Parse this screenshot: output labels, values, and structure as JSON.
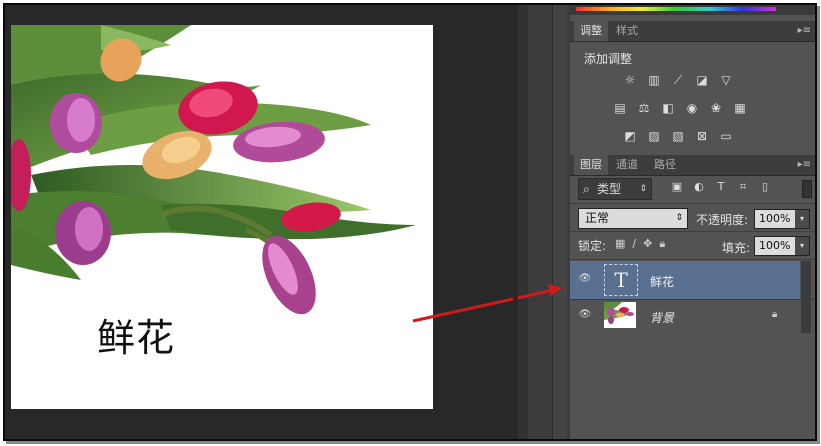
{
  "canvas": {
    "text": "鲜花"
  },
  "adjustments_panel": {
    "tabs": [
      {
        "label": "调整"
      },
      {
        "label": "样式"
      }
    ],
    "title": "添加调整",
    "rows": [
      [
        "sun-icon",
        "levels-icon",
        "curves-icon",
        "exposure-icon",
        "triangle-icon"
      ],
      [
        "vibrance-icon",
        "balance-icon",
        "black-white-icon",
        "photo-filter-icon",
        "channel-mixer-icon",
        "color-lookup-icon"
      ],
      [
        "invert-icon",
        "posterize-icon",
        "threshold-icon",
        "selective-color-icon",
        "gradient-map-icon"
      ]
    ]
  },
  "layers_panel": {
    "tabs": [
      {
        "label": "图层"
      },
      {
        "label": "通道"
      },
      {
        "label": "路径"
      }
    ],
    "filter_kind": "类型",
    "blend_mode": "正常",
    "opacity_label": "不透明度:",
    "opacity_value": "100%",
    "lock_label": "锁定:",
    "fill_label": "填充:",
    "fill_value": "100%",
    "layers": [
      {
        "name": "鲜花",
        "type": "text",
        "selected": true
      },
      {
        "name": "背景",
        "type": "image",
        "selected": false,
        "locked": true
      }
    ]
  },
  "colors": {
    "arrow": "#d21a1a",
    "selected_layer": "#5a7090",
    "panel_bg": "#535353"
  }
}
